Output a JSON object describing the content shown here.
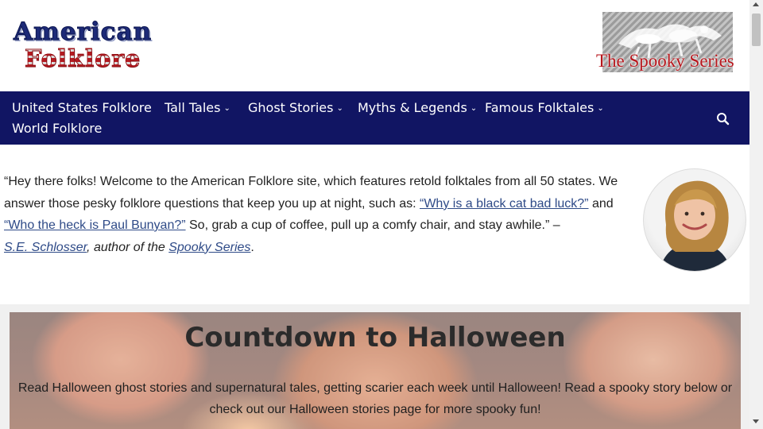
{
  "header": {
    "logo_line1": "American",
    "logo_line2": "Folklore",
    "badge_title": "The Spooky Series"
  },
  "nav": {
    "items": [
      {
        "label": "United States Folklore",
        "has_dropdown": false
      },
      {
        "label": "Tall Tales",
        "has_dropdown": true
      },
      {
        "label": "Ghost Stories",
        "has_dropdown": true
      },
      {
        "label": "Myths & Legends",
        "has_dropdown": true
      },
      {
        "label": "Famous Folktales",
        "has_dropdown": true
      },
      {
        "label": "World Folklore",
        "has_dropdown": false
      }
    ],
    "search_icon": "search-icon",
    "background": "#111563"
  },
  "intro": {
    "text_1": "“Hey there folks! Welcome to the American Folklore site, which features retold folktales from all 50 states. We answer those pesky folklore questions that keep you up at night, such as: ",
    "link_1": "“Why is a black cat bad luck?”",
    "text_2": " and ",
    "link_2": "“Who the heck is Paul Bunyan?”",
    "text_3": " So, grab a cup of coffee, pull up a comfy chair, and stay awhile.” –",
    "author_link": "S.E. Schlosser",
    "text_4": ", author of the ",
    "series_link": "Spooky Series",
    "text_5": ".",
    "link_color": "#2e4a87"
  },
  "halloween": {
    "heading": "Countdown to Halloween",
    "text": "Read Halloween ghost stories and supernatural tales, getting scarier each week until Halloween! Read a spooky story below or check out our Halloween stories page for more spooky fun!"
  }
}
